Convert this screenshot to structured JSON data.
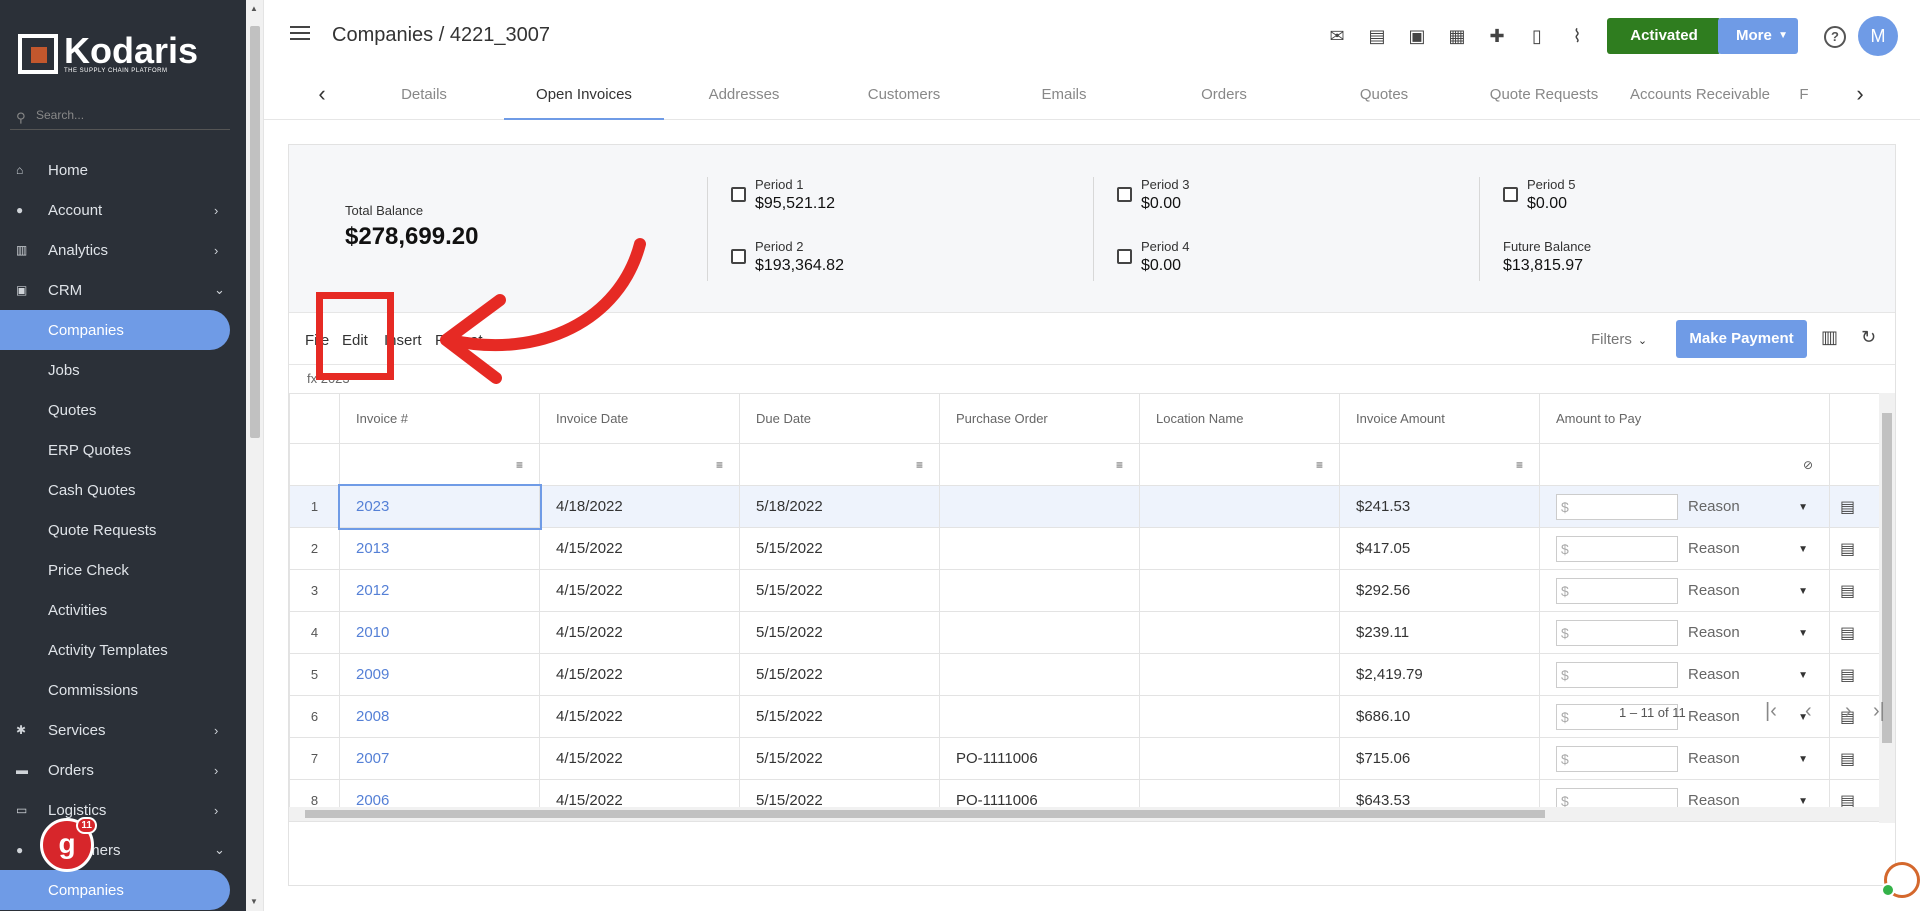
{
  "app": {
    "logo_name": "Kodaris",
    "logo_tagline": "THE SUPPLY CHAIN PLATFORM",
    "search_placeholder": "Search..."
  },
  "sidebar": {
    "items": [
      {
        "label": "Home",
        "icon": "home-icon"
      },
      {
        "label": "Account",
        "icon": "user-icon",
        "chevron": "›"
      },
      {
        "label": "Analytics",
        "icon": "chart-icon",
        "chevron": "›"
      },
      {
        "label": "CRM",
        "icon": "crm-icon",
        "chevron": "⌄"
      },
      {
        "label": "Companies",
        "active": true
      },
      {
        "label": "Jobs"
      },
      {
        "label": "Quotes"
      },
      {
        "label": "ERP Quotes"
      },
      {
        "label": "Cash Quotes"
      },
      {
        "label": "Quote Requests"
      },
      {
        "label": "Price Check"
      },
      {
        "label": "Activities"
      },
      {
        "label": "Activity Templates"
      },
      {
        "label": "Commissions"
      },
      {
        "label": "Services",
        "icon": "services-icon",
        "chevron": "›"
      },
      {
        "label": "Orders",
        "icon": "truck-icon",
        "chevron": "›"
      },
      {
        "label": "Logistics",
        "icon": "logistics-icon",
        "chevron": "›"
      },
      {
        "label": "Customers",
        "icon": "users-icon",
        "chevron": "⌄"
      },
      {
        "label": "Companies",
        "active": true
      }
    ],
    "badge": {
      "letter": "g",
      "count": "11"
    }
  },
  "header": {
    "breadcrumb": "Companies / 4221_3007",
    "activated_label": "Activated",
    "more_label": "More",
    "help_label": "?",
    "avatar_initial": "M"
  },
  "tabs": [
    "Details",
    "Open Invoices",
    "Addresses",
    "Customers",
    "Emails",
    "Orders",
    "Quotes",
    "Quote Requests",
    "Accounts Receivable",
    "F"
  ],
  "active_tab": "Open Invoices",
  "summary": {
    "total_label": "Total Balance",
    "total_value": "$278,699.20",
    "periods": [
      {
        "label": "Period 1",
        "value": "$95,521.12"
      },
      {
        "label": "Period 2",
        "value": "$193,364.82"
      },
      {
        "label": "Period 3",
        "value": "$0.00"
      },
      {
        "label": "Period 4",
        "value": "$0.00"
      },
      {
        "label": "Period 5",
        "value": "$0.00"
      },
      {
        "label": "Future Balance",
        "value": "$13,815.97"
      }
    ]
  },
  "toolbar": {
    "menus": [
      "File",
      "Edit",
      "Insert",
      "Format"
    ],
    "filters_label": "Filters",
    "pay_label": "Make Payment",
    "formula_bar": "fx 2023"
  },
  "table": {
    "columns": [
      "Invoice #",
      "Invoice Date",
      "Due Date",
      "Purchase Order",
      "Location Name",
      "Invoice Amount",
      "Amount to Pay"
    ],
    "amount_placeholder": "$",
    "reason_label": "Reason",
    "rows": [
      {
        "n": "1",
        "inv": "2023",
        "date": "4/18/2022",
        "due": "5/18/2022",
        "po": "",
        "loc": "",
        "amt": "$241.53"
      },
      {
        "n": "2",
        "inv": "2013",
        "date": "4/15/2022",
        "due": "5/15/2022",
        "po": "",
        "loc": "",
        "amt": "$417.05"
      },
      {
        "n": "3",
        "inv": "2012",
        "date": "4/15/2022",
        "due": "5/15/2022",
        "po": "",
        "loc": "",
        "amt": "$292.56"
      },
      {
        "n": "4",
        "inv": "2010",
        "date": "4/15/2022",
        "due": "5/15/2022",
        "po": "",
        "loc": "",
        "amt": "$239.11"
      },
      {
        "n": "5",
        "inv": "2009",
        "date": "4/15/2022",
        "due": "5/15/2022",
        "po": "",
        "loc": "",
        "amt": "$2,419.79"
      },
      {
        "n": "6",
        "inv": "2008",
        "date": "4/15/2022",
        "due": "5/15/2022",
        "po": "",
        "loc": "",
        "amt": "$686.10"
      },
      {
        "n": "7",
        "inv": "2007",
        "date": "4/15/2022",
        "due": "5/15/2022",
        "po": "PO-1111006",
        "loc": "",
        "amt": "$715.06"
      },
      {
        "n": "8",
        "inv": "2006",
        "date": "4/15/2022",
        "due": "5/15/2022",
        "po": "PO-1111006",
        "loc": "",
        "amt": "$643.53"
      }
    ]
  },
  "pager": {
    "range": "1 – 11 of 11"
  },
  "colors": {
    "sidebar_bg": "#2b3038",
    "accent": "#6f9be6",
    "activated": "#2f7d1f",
    "annotation": "#e62a24"
  }
}
